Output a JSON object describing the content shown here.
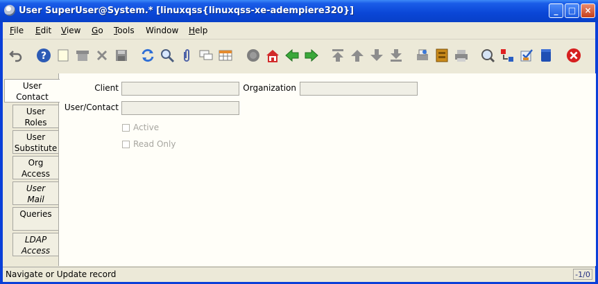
{
  "window": {
    "title": "User  SuperUser@System.* [linuxqss{linuxqss-xe-adempiere320}]",
    "controls": {
      "minimize": "_",
      "maximize": "□",
      "close": "×"
    }
  },
  "menu": [
    {
      "label": "File",
      "mnemonic": "F",
      "rest": "ile"
    },
    {
      "label": "Edit",
      "mnemonic": "E",
      "rest": "dit"
    },
    {
      "label": "View",
      "mnemonic": "V",
      "rest": "iew"
    },
    {
      "label": "Go",
      "mnemonic": "G",
      "rest": "o"
    },
    {
      "label": "Tools",
      "mnemonic": "T",
      "rest": "ools"
    },
    {
      "label": "Window",
      "mnemonic": "",
      "rest": "Window"
    },
    {
      "label": "Help",
      "mnemonic": "H",
      "rest": "elp"
    }
  ],
  "toolbar_icons": [
    "undo-icon",
    "help-icon",
    "new-record-icon",
    "delete-icon",
    "delete-selection-icon",
    "save-icon",
    "refresh-icon",
    "find-icon",
    "attachment-icon",
    "chat-icon",
    "grid-toggle-icon",
    "history-icon",
    "home-icon",
    "parent-icon",
    "detail-icon",
    "first-record-icon",
    "previous-record-icon",
    "next-record-icon",
    "last-record-icon",
    "report-icon",
    "archive-icon",
    "print-icon",
    "zoom-across-icon",
    "active-workflows-icon",
    "requests-icon",
    "product-info-icon",
    "exit-icon"
  ],
  "tabs": [
    {
      "line1": "User",
      "line2": "Contact"
    },
    {
      "line1": "User",
      "line2": "Roles"
    },
    {
      "line1": "User",
      "line2": "Substitute"
    },
    {
      "line1": "Org",
      "line2": "Access"
    },
    {
      "line1": "User",
      "line2": "Mail"
    },
    {
      "line1": "Queries",
      "line2": ""
    },
    {
      "line1": "LDAP",
      "line2": "Access"
    }
  ],
  "form": {
    "client_label": "Client",
    "client_value": "",
    "organization_label": "Organization",
    "organization_value": "",
    "user_contact_label": "User/Contact",
    "user_contact_value": "",
    "active_label": "Active",
    "active_checked": false,
    "readonly_label": "Read Only",
    "readonly_checked": false
  },
  "status": {
    "message": "Navigate or Update record",
    "record_count": "-1/0"
  },
  "colors": {
    "title_bar": "#0a46d6",
    "window_bg": "#ece9d8",
    "panel_bg": "#fffef8",
    "field_bg": "#f0efe6"
  }
}
